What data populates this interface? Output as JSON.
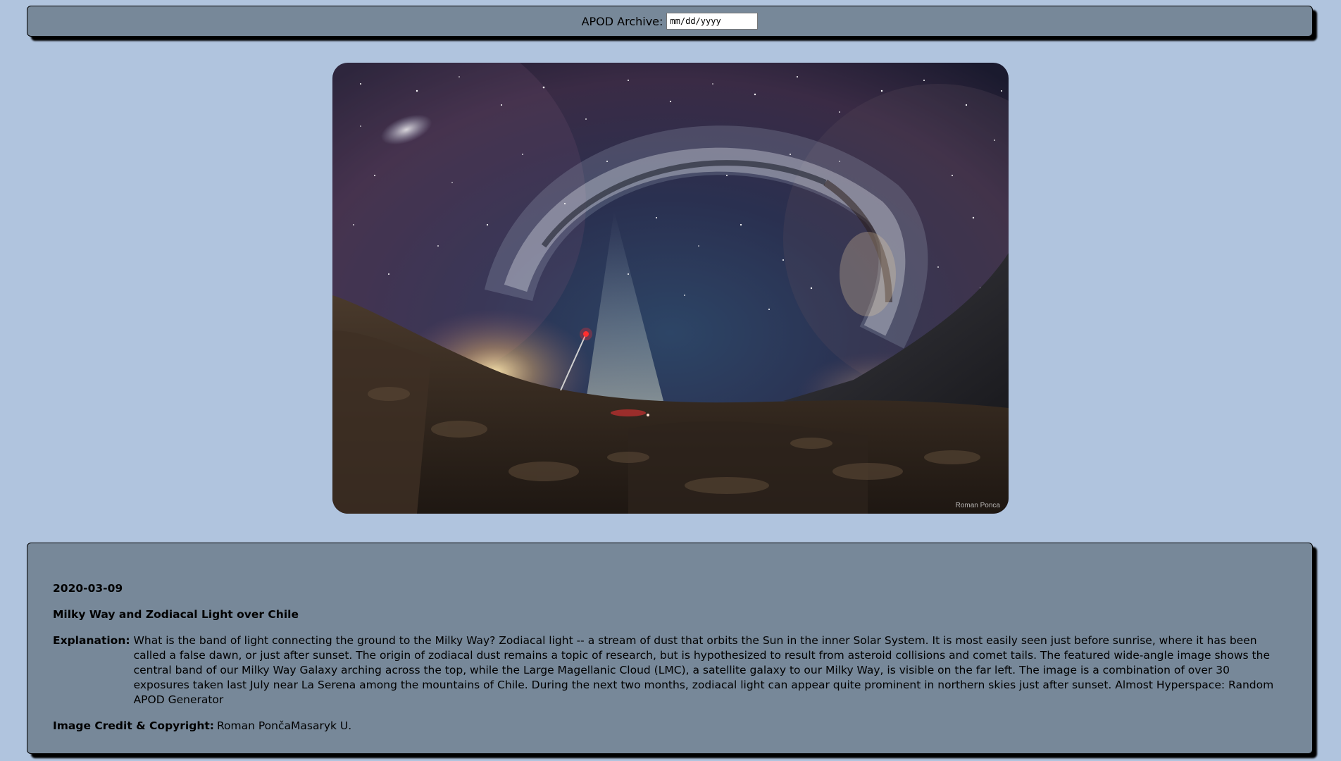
{
  "header": {
    "archive_label": "APOD Archive:",
    "date_placeholder": "mm/dd/yyyy"
  },
  "image": {
    "watermark": "Roman Ponca"
  },
  "entry": {
    "date": "2020-03-09",
    "title": "Milky Way and Zodiacal Light over Chile",
    "explanation_label": "Explanation:",
    "explanation": "What is the band of light connecting the ground to the Milky Way? Zodiacal light -- a stream of dust that orbits the Sun in the inner Solar System. It is most easily seen just before sunrise, where it has been called a false dawn, or just after sunset. The origin of zodiacal dust remains a topic of research, but is hypothesized to result from asteroid collisions and comet tails. The featured wide-angle image shows the central band of our Milky Way Galaxy arching across the top, while the Large Magellanic Cloud (LMC), a satellite galaxy to our Milky Way, is visible on the far left. The image is a combination of over 30 exposures taken last July near La Serena among the mountains of Chile. During the next two months, zodiacal light can appear quite prominent in northern skies just after sunset. Almost Hyperspace: Random APOD Generator",
    "credit_label": "Image Credit & Copyright:",
    "credit": "Roman PončaMasaryk U."
  },
  "colors": {
    "page_background": "#b0c4de",
    "panel_background": "#778899"
  }
}
